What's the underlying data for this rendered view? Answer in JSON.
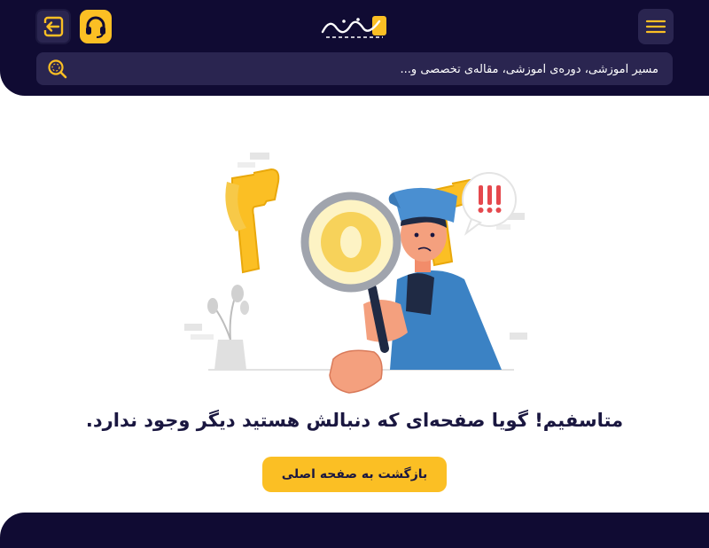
{
  "header": {
    "logo_text": "رکاب اکادمی",
    "search_placeholder": "مسیر آموزشی، دوره‌ی آموزشی، مقاله‌ی تخصصی و..."
  },
  "error_page": {
    "code": "404",
    "message": "متاسفیم! گویا صفحه‌ای که دنبالش هستید دیگر وجود ندارد.",
    "home_button_label": "بازگشت به صفحه اصلی"
  },
  "colors": {
    "brand_dark": "#100b33",
    "accent_yellow": "#fbbf24",
    "search_bg": "#2a2550"
  },
  "icons": [
    "login-icon",
    "headset-icon",
    "hamburger-menu-icon",
    "search-icon"
  ]
}
